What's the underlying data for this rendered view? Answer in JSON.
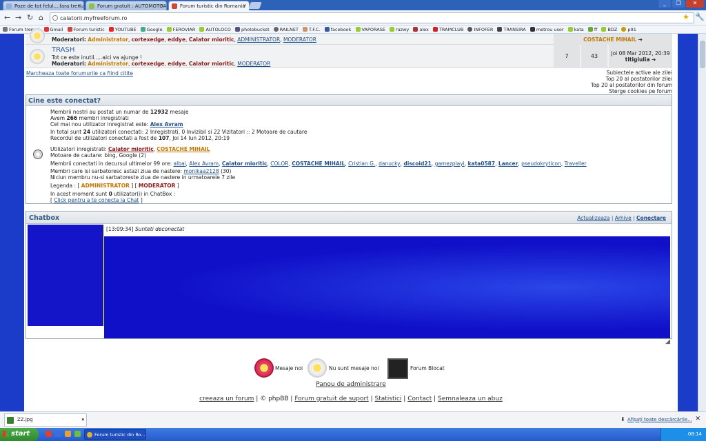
{
  "tabs": [
    {
      "label": "Poze de tot felul....fara trenu"
    },
    {
      "label": "Forum gratuit : AUTOMOTOAI"
    },
    {
      "label": "Forum turistic din Romania"
    }
  ],
  "url": "calatorii.myfreeforum.ro",
  "bookmarks": [
    "Forum trenuri",
    "Gmail",
    "Forum turistic",
    "YOUTUBE",
    "Google",
    "FEROVIAR",
    "AUTOLOCO",
    "photobucket",
    "RAILNET",
    "T.F.C.",
    "facebook",
    "VAPORASE",
    "razwy",
    "alex",
    "TRAMCLUB",
    "INFOFER",
    "TRANSIRA",
    "metrou usor",
    "kata",
    "ff",
    "BDZ",
    "p91"
  ],
  "forum_top": {
    "mod_label": "Moderatori:",
    "mods": [
      "Administrator",
      "cortexedge",
      "eddye",
      "Calator mioritic",
      "ADMINISTRATOR",
      "MODERATOR"
    ],
    "last_user": "COSTACHE MIHAIL"
  },
  "trash": {
    "title": "TRASH",
    "desc": "Tot ce este inutil.....aici va ajunge !",
    "mods": [
      "Administrator",
      "cortexedge",
      "eddye",
      "Calator mioritic",
      "MODERATOR"
    ],
    "topics": "7",
    "posts": "43",
    "last_date": "Joi 08 Mar 2012, 20:39",
    "last_user": "titigiulia"
  },
  "mark_read": "Marcheaza toate forumurile ca fiind citite",
  "right_links": [
    "Subiectele active ale zilei",
    "Top 20 al postatorilor zilei",
    "Top 20 al postatorilor din forum",
    "Sterge cookies pe forum"
  ],
  "who": {
    "title": "Cine este conectat?",
    "l1a": "Membrii nostri au postat un numar de ",
    "posts": "12932",
    "l1b": " mesaje",
    "l2a": "Avem ",
    "members": "266",
    "l2b": " membri inregistrati",
    "l3": "Cel mai nou utilizator inregistrat este: ",
    "newest": "Alex Avram",
    "l4a": "In total sunt ",
    "online": "24",
    "l4b": " utilizatori conectati: 2 Inregistrati, 0 Invizibil si 22 Vizitatori :: 2 Motoare de cautare",
    "l5a": "Recordul de utilizatori conectati a fost de ",
    "record": "107",
    "l5b": ", Joi 14 Iun 2012, 20:19",
    "reg_label": "Utilizatori inregistrati: ",
    "reg1": "Calator mioritic",
    "reg2": "COSTACHE MIHAIL",
    "bots": "Motoare de cautare: bing, Google (2)",
    "last99_label": "Membrii conectati in decursul ultimelor 99 ore: ",
    "last99": [
      "albai",
      "Alex Avram",
      "Calator mioritic",
      "COLOR",
      "COSTACHE MIHAIL",
      "Cristian G.",
      "danucky",
      "discoid21",
      "gamezplayi",
      "kata0587",
      "Lancer",
      "pseudokryticon",
      "Traveller"
    ],
    "bday_label": "Membri care isi sarbatoresc astazi ziua de nastere: ",
    "bday_user": "monikaa2128",
    "bday_age": "(30)",
    "bday_next": "Niciun membru nu-si sarbatoreste ziua de nastere in urmatoarele 7 zile",
    "legend_label": "Legenda :",
    "legend_admin": "ADMINISTRATOR",
    "legend_mod": "MODERATOR",
    "chat_count_a": "In acest moment sunt ",
    "chat_count": "0",
    "chat_count_b": " utilizator(i) in ChatBox :",
    "chat_link": "Click pentru a te conecta la Chat"
  },
  "chatbox": {
    "title": "Chatbox",
    "links": [
      "Actualizeaza",
      "Arhive",
      "Conectare"
    ],
    "time": "[13:09:34]",
    "msg": "Sunteti deconectat"
  },
  "legend": {
    "new": "Mesaje noi",
    "none": "Nu sunt mesaje noi",
    "locked": "Forum Blocat"
  },
  "admin_panel": "Panou de administrare",
  "footer": [
    "creeaza un forum",
    "© phpBB",
    "Forum gratuit de suport",
    "Statistici",
    "Contact",
    "Semnaleaza un abuz"
  ],
  "download": {
    "file": "ZZ.jpg",
    "show_all": "Afișați toate descărcările..."
  },
  "taskbar": {
    "start": "start",
    "task": "Forum turistic din Ro...",
    "clock": "08:14"
  },
  "colors": {
    "bg_blue": "#1a3cc8",
    "admin_orange": "#c47800",
    "mod_red": "#8b1a1a",
    "link": "#1f4f8a"
  }
}
